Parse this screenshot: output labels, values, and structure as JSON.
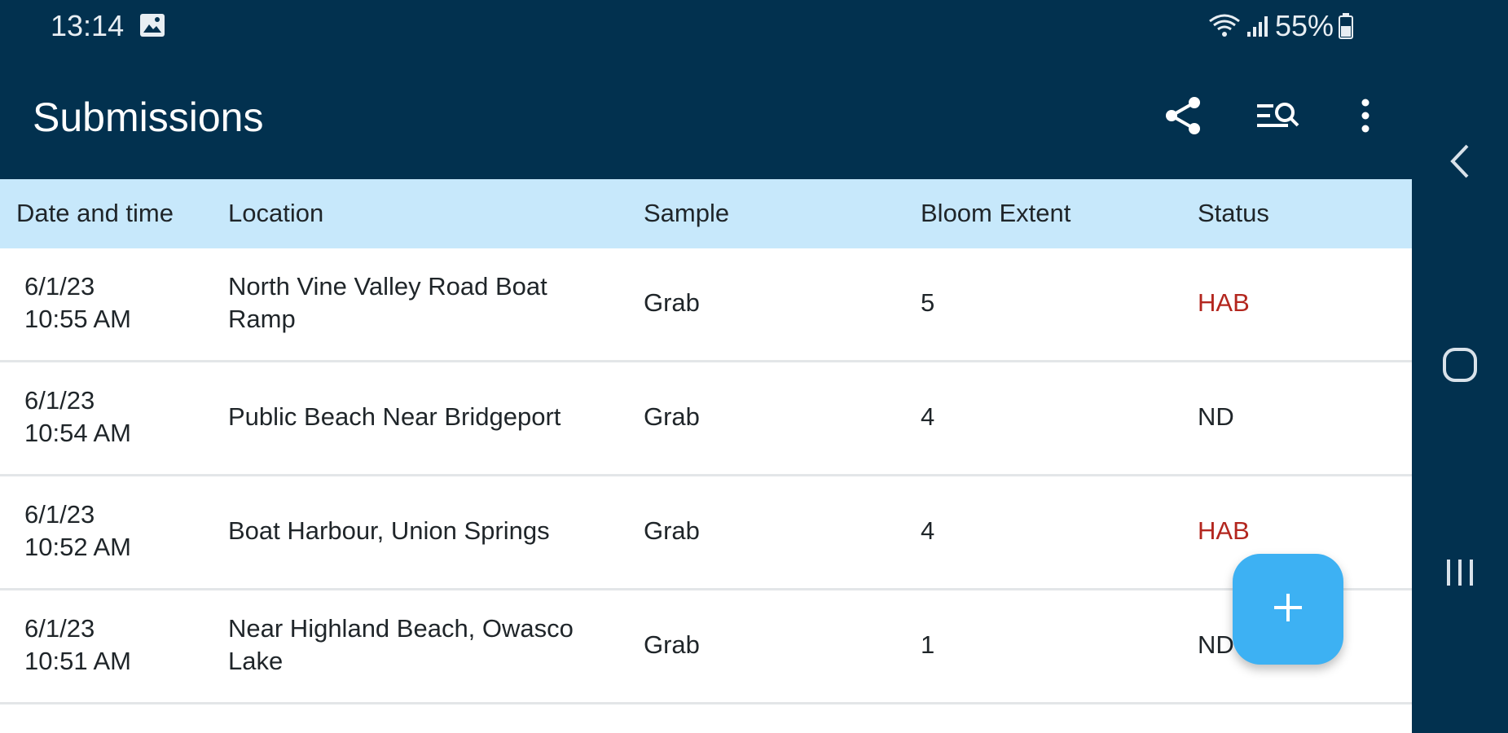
{
  "status_bar": {
    "time": "13:14",
    "battery": "55%",
    "icons": [
      "image-icon",
      "wifi-icon",
      "signal-icon",
      "battery-icon"
    ]
  },
  "app_bar": {
    "title": "Submissions",
    "actions": [
      "share-icon",
      "search-filter-icon",
      "more-vert-icon"
    ]
  },
  "table": {
    "columns": [
      "Date and time",
      "Location",
      "Sample",
      "Bloom Extent",
      "Status"
    ],
    "rows": [
      {
        "date": "6/1/23",
        "time": "10:55 AM",
        "location_line1": "North Vine Valley Road Boat",
        "location_line2": "Ramp",
        "sample": "Grab",
        "bloom_extent": "5",
        "status": "HAB"
      },
      {
        "date": "6/1/23",
        "time": "10:54 AM",
        "location_line1": "Public Beach Near Bridgeport",
        "location_line2": "",
        "sample": "Grab",
        "bloom_extent": "4",
        "status": "ND"
      },
      {
        "date": "6/1/23",
        "time": "10:52 AM",
        "location_line1": "Boat Harbour, Union Springs",
        "location_line2": "",
        "sample": "Grab",
        "bloom_extent": "4",
        "status": "HAB"
      },
      {
        "date": "6/1/23",
        "time": "10:51 AM",
        "location_line1": "Near Highland Beach, Owasco",
        "location_line2": "Lake",
        "sample": "Grab",
        "bloom_extent": "1",
        "status": "ND"
      }
    ]
  },
  "fab": {
    "icon": "plus-icon"
  },
  "system_nav": {
    "buttons": [
      "back-icon",
      "home-icon",
      "recents-icon"
    ]
  },
  "colors": {
    "app_bar": "#02314f",
    "table_header": "#c7e8fb",
    "hab_status": "#b3261e",
    "fab": "#3db1f3"
  }
}
